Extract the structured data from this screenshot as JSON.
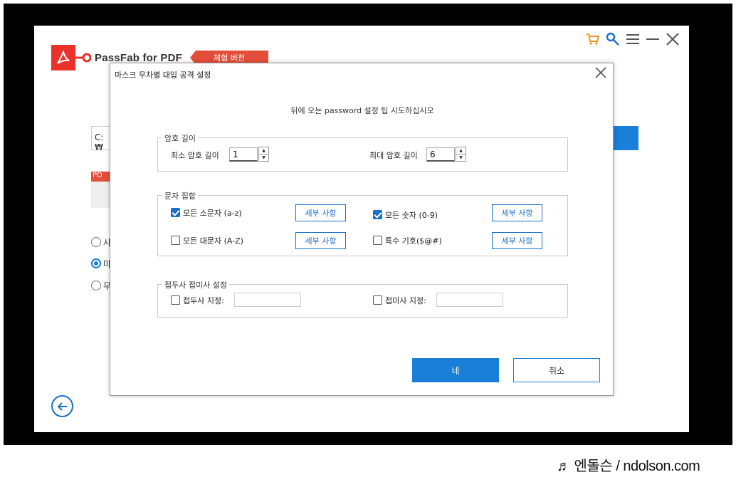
{
  "app": {
    "title": "PassFab for PDF",
    "trial_badge": "체험 버전",
    "path_prefix": "C:₩",
    "pdf_tag": "PD",
    "attack_modes": [
      {
        "label": "사",
        "selected": false
      },
      {
        "label": "마",
        "selected": true
      },
      {
        "label": "무",
        "selected": false
      }
    ],
    "top_icons": [
      "cart-icon",
      "key-icon",
      "menu-icon",
      "minimize-icon",
      "close-icon"
    ]
  },
  "dialog": {
    "title": "마스크 무차별 대입 공격 설정",
    "hint": "뒤에 오는 password 설정 팁 시도하십시오",
    "length_group": {
      "title": "암호 길이",
      "min_label": "최소 암호 길이",
      "min_value": "1",
      "max_label": "최대 암호 길이",
      "max_value": "6"
    },
    "charset_group": {
      "title": "문자 집합",
      "items": [
        {
          "label": "모든 소문자 (a-z)",
          "checked": true,
          "detail": "세부 사항"
        },
        {
          "label": "모든 숫자 (0-9)",
          "checked": true,
          "detail": "세부 사항"
        },
        {
          "label": "모든 대문자 (A-Z)",
          "checked": false,
          "detail": "세부 사항"
        },
        {
          "label": "특수 기호($@#)",
          "checked": false,
          "detail": "세부 사항"
        }
      ]
    },
    "affix_group": {
      "title": "접두사 접미사 설정",
      "prefix_label": "접두사 지정:",
      "prefix_value": "",
      "suffix_label": "접미사 지정:",
      "suffix_value": ""
    },
    "ok_label": "네",
    "cancel_label": "취소"
  },
  "watermark": "♬ 엔돌슨 / ndolson.com",
  "colors": {
    "accent": "#1a7fd9",
    "brand_red": "#e8322b",
    "frame": "#000000"
  }
}
